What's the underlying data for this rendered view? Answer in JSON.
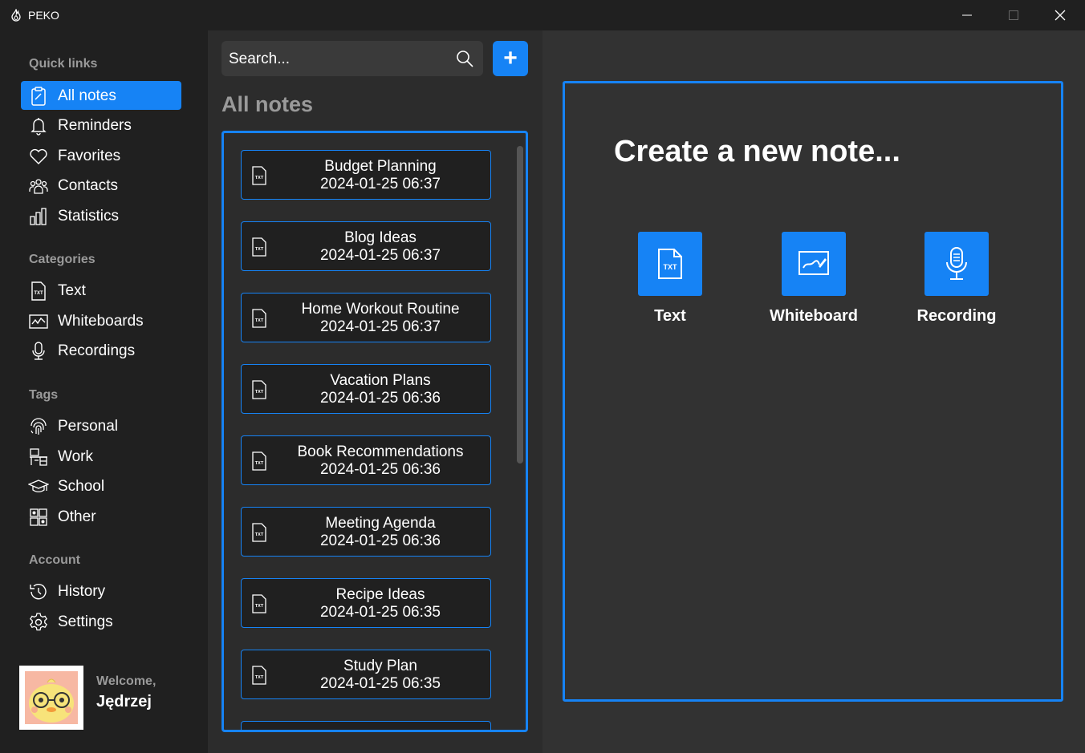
{
  "window": {
    "title": "PEKO"
  },
  "sidebar": {
    "quick_links_title": "Quick links",
    "quick_links": [
      {
        "label": "All notes",
        "icon": "clipboard-icon",
        "active": true
      },
      {
        "label": "Reminders",
        "icon": "bell-icon"
      },
      {
        "label": "Favorites",
        "icon": "heart-icon"
      },
      {
        "label": "Contacts",
        "icon": "people-icon"
      },
      {
        "label": "Statistics",
        "icon": "bar-chart-icon"
      }
    ],
    "categories_title": "Categories",
    "categories": [
      {
        "label": "Text",
        "icon": "txt-file-icon"
      },
      {
        "label": "Whiteboards",
        "icon": "whiteboard-icon"
      },
      {
        "label": "Recordings",
        "icon": "microphone-icon"
      }
    ],
    "tags_title": "Tags",
    "tags": [
      {
        "label": "Personal",
        "icon": "fingerprint-icon"
      },
      {
        "label": "Work",
        "icon": "desk-icon"
      },
      {
        "label": "School",
        "icon": "graduation-cap-icon"
      },
      {
        "label": "Other",
        "icon": "grid-icon"
      }
    ],
    "account_title": "Account",
    "account": [
      {
        "label": "History",
        "icon": "history-icon"
      },
      {
        "label": "Settings",
        "icon": "gear-icon"
      }
    ],
    "user": {
      "welcome": "Welcome,",
      "name": "Jędrzej"
    }
  },
  "notes": {
    "search_placeholder": "Search...",
    "add_label": "+",
    "title": "All notes",
    "items": [
      {
        "title": "Budget Planning",
        "date": "2024-01-25 06:37"
      },
      {
        "title": "Blog Ideas",
        "date": "2024-01-25 06:37"
      },
      {
        "title": "Home Workout Routine",
        "date": "2024-01-25 06:37"
      },
      {
        "title": "Vacation Plans",
        "date": "2024-01-25 06:36"
      },
      {
        "title": "Book Recommendations",
        "date": "2024-01-25 06:36"
      },
      {
        "title": "Meeting Agenda",
        "date": "2024-01-25 06:36"
      },
      {
        "title": "Recipe Ideas",
        "date": "2024-01-25 06:35"
      },
      {
        "title": "Study Plan",
        "date": "2024-01-25 06:35"
      }
    ]
  },
  "create": {
    "title": "Create a new note...",
    "options": [
      {
        "label": "Text",
        "icon": "txt-file-icon"
      },
      {
        "label": "Whiteboard",
        "icon": "whiteboard-icon"
      },
      {
        "label": "Recording",
        "icon": "microphone-icon"
      }
    ]
  },
  "colors": {
    "accent": "#1683f5",
    "sidebar_bg": "#202020",
    "list_bg": "#2c2c2c",
    "panel_bg": "#323232"
  }
}
